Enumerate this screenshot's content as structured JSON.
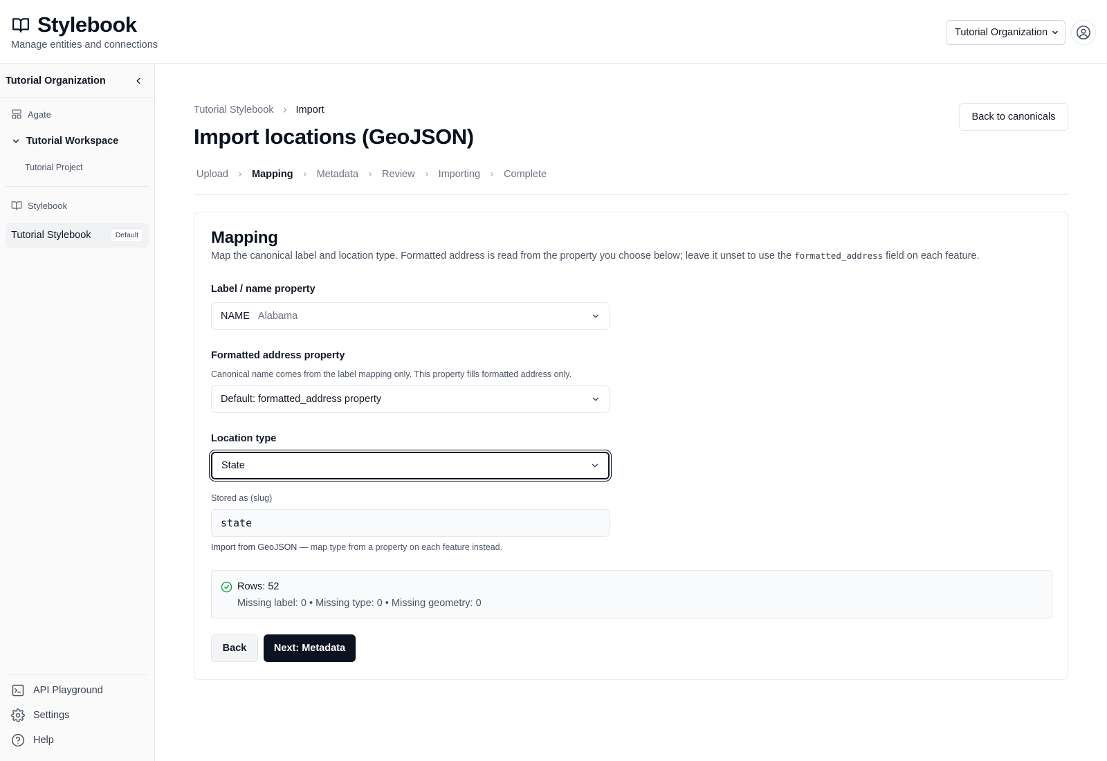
{
  "header": {
    "app_title": "Stylebook",
    "subtitle": "Manage entities and connections",
    "org_selector": {
      "selected": "Tutorial Organization"
    }
  },
  "sidebar": {
    "org_name": "Tutorial Organization",
    "agate_label": "Agate",
    "workspace_label": "Tutorial Workspace",
    "project_label": "Tutorial Project",
    "stylebook_section_label": "Stylebook",
    "active_item": {
      "label": "Tutorial Stylebook",
      "badge": "Default"
    },
    "footer": {
      "api_playground": "API Playground",
      "settings": "Settings",
      "help": "Help"
    }
  },
  "breadcrumb": {
    "parent": "Tutorial Stylebook",
    "current": "Import"
  },
  "page_title": "Import locations (GeoJSON)",
  "back_button_label": "Back to canonicals",
  "steps": [
    {
      "label": "Upload",
      "active": false
    },
    {
      "label": "Mapping",
      "active": true
    },
    {
      "label": "Metadata",
      "active": false
    },
    {
      "label": "Review",
      "active": false
    },
    {
      "label": "Importing",
      "active": false
    },
    {
      "label": "Complete",
      "active": false
    }
  ],
  "card": {
    "title": "Mapping",
    "description_before": "Map the canonical label and location type. Formatted address is read from the property you choose below; leave it unset to use the ",
    "description_code": "formatted_address",
    "description_after": " field on each feature.",
    "label_field": {
      "label": "Label / name property",
      "selected_key": "NAME",
      "selected_sample": "Alabama"
    },
    "address_field": {
      "label": "Formatted address property",
      "help": "Canonical name comes from the label mapping only. This property fills formatted address only.",
      "selected": "Default: formatted_address property"
    },
    "location_type_field": {
      "label": "Location type",
      "selected": "State"
    },
    "slug": {
      "label": "Stored as (slug)",
      "value": "state"
    },
    "import_note": {
      "link": "Import from GeoJSON",
      "text": " — map type from a property on each feature instead."
    },
    "summary": {
      "rows": "Rows: 52",
      "details": "Missing label: 0 • Missing type: 0 • Missing geometry: 0"
    },
    "back_label": "Back",
    "next_label": "Next: Metadata"
  },
  "colors": {
    "primary": "#0b1220",
    "border": "#e5e7eb",
    "success": "#16a34a",
    "muted_text": "#4b5563"
  }
}
